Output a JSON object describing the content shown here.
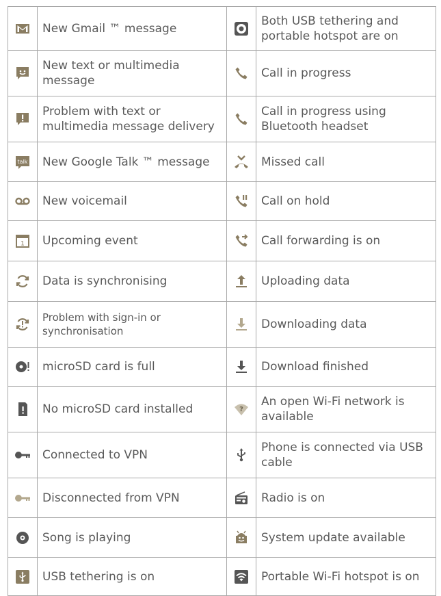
{
  "colors": {
    "icon": "#8a7d62",
    "text": "#5a5a5a",
    "border": "#a8a8a8"
  },
  "rows": [
    {
      "left": {
        "icon": "gmail-icon",
        "label": "New Gmail ™ message"
      },
      "right": {
        "icon": "usb-and-hotspot-icon",
        "label": "Both USB tethering and portable hotspot are on"
      }
    },
    {
      "left": {
        "icon": "text-message-icon",
        "label": "New text or multimedia message"
      },
      "right": {
        "icon": "phone-icon",
        "label": "Call in progress"
      }
    },
    {
      "left": {
        "icon": "message-problem-icon",
        "label": "Problem with text or multimedia message delivery"
      },
      "right": {
        "icon": "phone-bluetooth-icon",
        "label": "Call in progress using Bluetooth headset"
      }
    },
    {
      "left": {
        "icon": "google-talk-icon",
        "label": "New Google Talk ™ message"
      },
      "right": {
        "icon": "missed-call-icon",
        "label": "Missed call"
      }
    },
    {
      "left": {
        "icon": "voicemail-icon",
        "label": "New voicemail"
      },
      "right": {
        "icon": "call-hold-icon",
        "label": "Call on hold"
      }
    },
    {
      "left": {
        "icon": "calendar-icon",
        "label": "Upcoming event"
      },
      "right": {
        "icon": "call-forward-icon",
        "label": "Call forwarding is on"
      }
    },
    {
      "left": {
        "icon": "sync-icon",
        "label": "Data is synchronising"
      },
      "right": {
        "icon": "upload-icon",
        "label": "Uploading data"
      }
    },
    {
      "left": {
        "icon": "sync-problem-icon",
        "label": "Problem with sign-in or synchronisation"
      },
      "right": {
        "icon": "download-icon",
        "label": "Downloading data"
      }
    },
    {
      "left": {
        "icon": "sd-card-full-icon",
        "label": "microSD card is full"
      },
      "right": {
        "icon": "download-finished-icon",
        "label": "Download finished"
      }
    },
    {
      "left": {
        "icon": "no-sd-card-icon",
        "label": "No microSD card installed"
      },
      "right": {
        "icon": "open-wifi-icon",
        "label": "An open Wi-Fi network is available"
      }
    },
    {
      "left": {
        "icon": "vpn-key-icon",
        "label": "Connected to VPN"
      },
      "right": {
        "icon": "usb-icon",
        "label": "Phone is connected via USB cable"
      }
    },
    {
      "left": {
        "icon": "vpn-key-disconnected-icon",
        "label": "Disconnected from VPN"
      },
      "right": {
        "icon": "radio-icon",
        "label": "Radio is on"
      }
    },
    {
      "left": {
        "icon": "song-playing-icon",
        "label": "Song is playing"
      },
      "right": {
        "icon": "system-update-icon",
        "label": "System update available"
      }
    },
    {
      "left": {
        "icon": "usb-tethering-icon",
        "label": "USB tethering is on"
      },
      "right": {
        "icon": "wifi-hotspot-icon",
        "label": "Portable Wi-Fi hotspot is on"
      }
    }
  ]
}
